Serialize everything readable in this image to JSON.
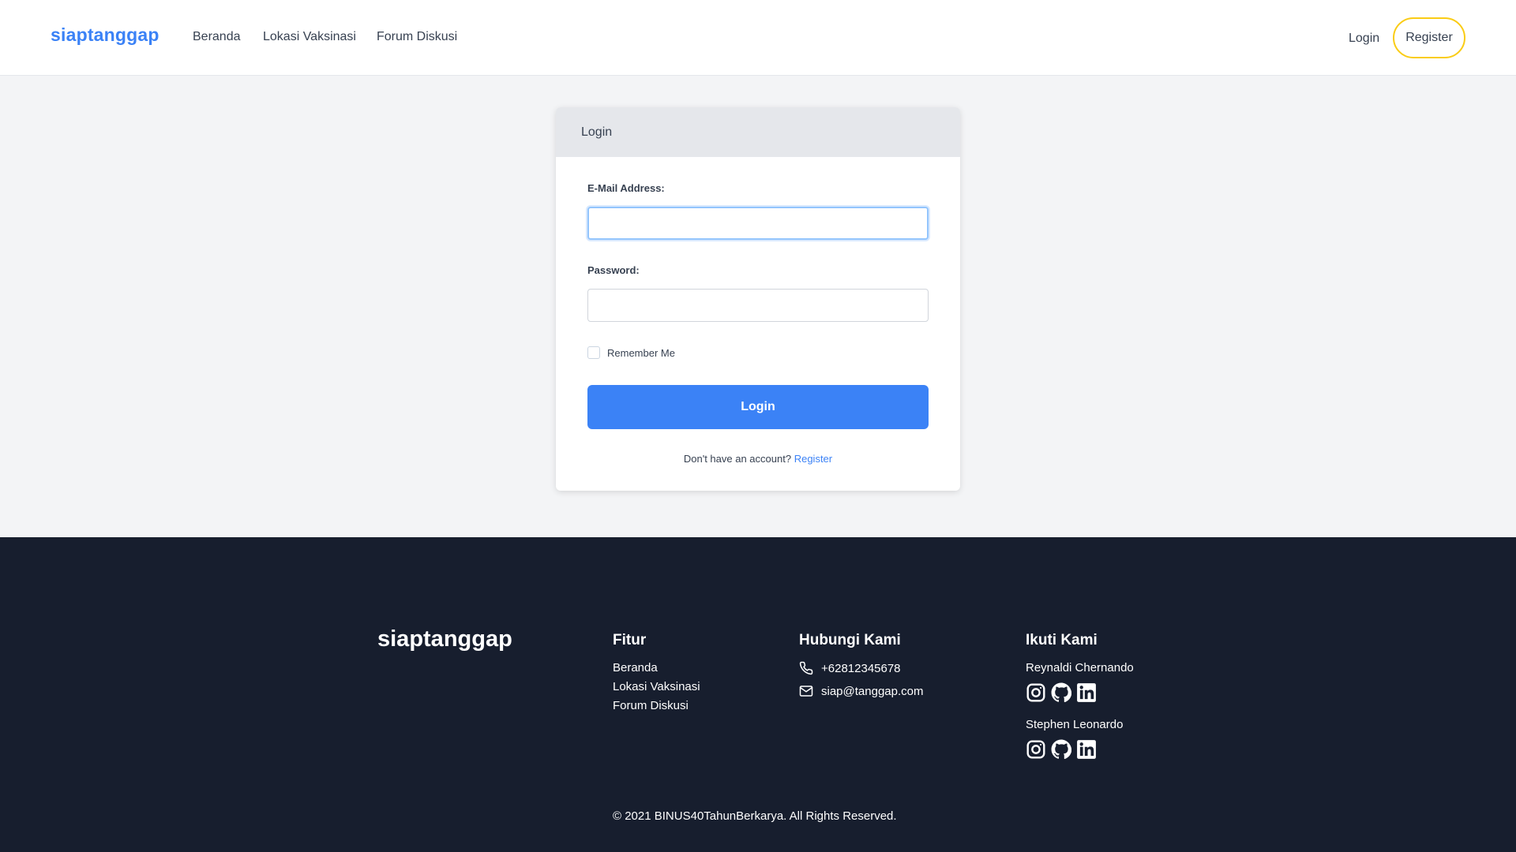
{
  "header": {
    "brand": "siaptanggap",
    "nav": [
      "Beranda",
      "Lokasi Vaksinasi",
      "Forum Diskusi"
    ],
    "login": "Login",
    "register": "Register"
  },
  "card": {
    "title": "Login",
    "email_label": "E-Mail Address:",
    "email_value": "",
    "password_label": "Password:",
    "password_value": "",
    "remember_label": "Remember Me",
    "remember_checked": false,
    "submit_label": "Login",
    "no_account_text": "Don't have an account?",
    "register_link": "Register"
  },
  "footer": {
    "brand": "siaptanggap",
    "features": {
      "title": "Fitur",
      "links": [
        "Beranda",
        "Lokasi Vaksinasi",
        "Forum Diskusi"
      ]
    },
    "contact": {
      "title": "Hubungi Kami",
      "phone": "+62812345678",
      "phone_icon": "phone-icon",
      "email": "siap@tanggap.com",
      "email_icon": "mail-icon"
    },
    "follow": {
      "title": "Ikuti Kami",
      "people": [
        {
          "name": "Reynaldi Chernando",
          "icons": [
            "instagram-icon",
            "github-icon",
            "linkedin-icon"
          ]
        },
        {
          "name": "Stephen Leonardo",
          "icons": [
            "instagram-icon",
            "github-icon",
            "linkedin-icon"
          ]
        }
      ]
    },
    "copyright": "© 2021 BINUS40TahunBerkarya. All Rights Reserved."
  },
  "colors": {
    "accent": "#3b82f6",
    "register_border": "#facc15",
    "footer_bg": "#171e2e",
    "page_bg": "#f3f4f6"
  }
}
